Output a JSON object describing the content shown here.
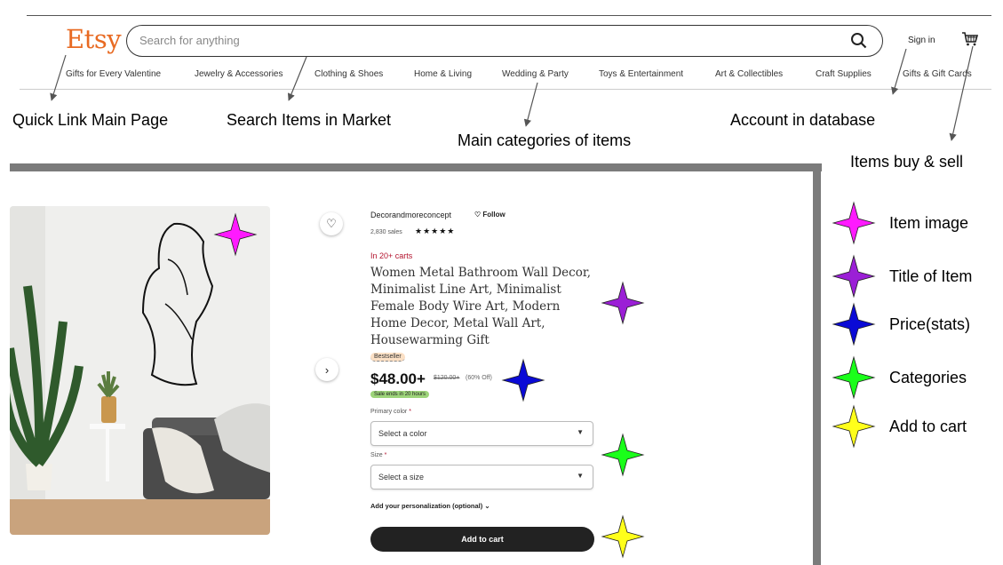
{
  "header": {
    "logo": "Etsy",
    "search_placeholder": "Search for anything",
    "signin": "Sign in"
  },
  "nav": [
    "Gifts for Every Valentine",
    "Jewelry & Accessories",
    "Clothing & Shoes",
    "Home & Living",
    "Wedding & Party",
    "Toys & Entertainment",
    "Art & Collectibles",
    "Craft Supplies",
    "Gifts & Gift Cards"
  ],
  "annotations": {
    "quick_link": "Quick Link Main Page",
    "search_items": "Search Items in Market",
    "main_categories": "Main categories of items",
    "account": "Account in database",
    "items_buy_sell": "Items buy & sell"
  },
  "product": {
    "shop": "Decorandmoreconcept",
    "follow": "Follow",
    "sales": "2,830 sales",
    "stars": "★★★★★",
    "carts": "In 20+ carts",
    "title": "Women Metal Bathroom Wall Decor, Minimalist Line Art, Minimalist Female Body Wire Art, Modern Home Decor, Metal Wall Art, Housewarming Gift",
    "badge": "Bestseller",
    "price": "$48.00+",
    "old_price": "$120.00+",
    "discount": "(60% Off)",
    "sale_ends": "Sale ends in 20 hours",
    "primary_color_label": "Primary color",
    "color_select": "Select a color",
    "size_label": "Size",
    "size_select": "Select a size",
    "personalization": "Add your personalization (optional)",
    "add_to_cart": "Add to cart",
    "required_mark": "*"
  },
  "legend": [
    {
      "label": "Item image",
      "color": "#ff1aff"
    },
    {
      "label": "Title of Item",
      "color": "#9b1fd6"
    },
    {
      "label": "Price(stats)",
      "color": "#0a0ad6"
    },
    {
      "label": "Categories",
      "color": "#1aff1a"
    },
    {
      "label": "Add to cart",
      "color": "#ffff1a"
    }
  ],
  "colors": {
    "brand": "#e86a22",
    "frame": "#7b7b7b"
  }
}
